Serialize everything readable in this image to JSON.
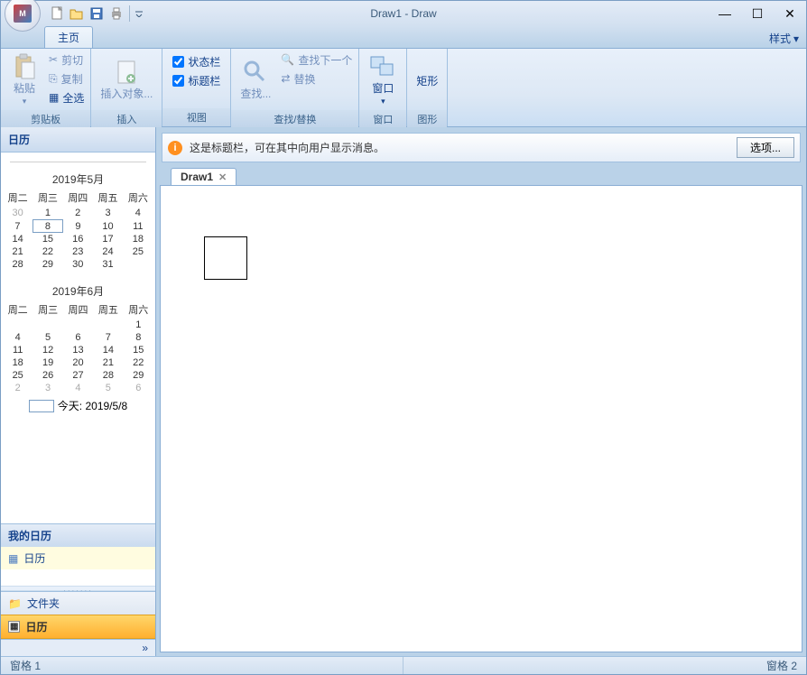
{
  "window": {
    "title": "Draw1 - Draw",
    "minimize": "—",
    "maximize": "☐",
    "close": "✕"
  },
  "qat": {
    "new": "新建",
    "open": "打开",
    "save": "保存",
    "print": "打印"
  },
  "tabs": {
    "home": "主页",
    "style_menu": "样式"
  },
  "ribbon": {
    "clipboard": {
      "label": "剪贴板",
      "paste": "粘贴",
      "cut": "剪切",
      "copy": "复制",
      "select_all": "全选"
    },
    "insert": {
      "label": "插入",
      "insert_object": "插入对象..."
    },
    "view": {
      "label": "视图",
      "statusbar": "状态栏",
      "titlebar": "标题栏"
    },
    "find_replace": {
      "label": "查找/替换",
      "find": "查找...",
      "find_next": "查找下一个",
      "replace": "替换"
    },
    "window": {
      "label": "窗口",
      "btn": "窗口"
    },
    "shapes": {
      "label": "图形",
      "rect": "矩形"
    }
  },
  "sidebar": {
    "calendar_title": "日历",
    "month1": {
      "title": "2019年5月",
      "dow": [
        "周二",
        "周三",
        "周四",
        "周五",
        "周六"
      ],
      "rows": [
        [
          {
            "v": "30",
            "dim": true
          },
          {
            "v": "1"
          },
          {
            "v": "2"
          },
          {
            "v": "3"
          },
          {
            "v": "4"
          }
        ],
        [
          {
            "v": "7"
          },
          {
            "v": "8",
            "sel": true
          },
          {
            "v": "9"
          },
          {
            "v": "10"
          },
          {
            "v": "11"
          }
        ],
        [
          {
            "v": "14"
          },
          {
            "v": "15"
          },
          {
            "v": "16"
          },
          {
            "v": "17"
          },
          {
            "v": "18"
          }
        ],
        [
          {
            "v": "21"
          },
          {
            "v": "22"
          },
          {
            "v": "23"
          },
          {
            "v": "24"
          },
          {
            "v": "25"
          }
        ],
        [
          {
            "v": "28"
          },
          {
            "v": "29"
          },
          {
            "v": "30"
          },
          {
            "v": "31"
          },
          {
            "v": ""
          }
        ]
      ]
    },
    "month2": {
      "title": "2019年6月",
      "dow": [
        "周二",
        "周三",
        "周四",
        "周五",
        "周六"
      ],
      "rows": [
        [
          {
            "v": ""
          },
          {
            "v": ""
          },
          {
            "v": ""
          },
          {
            "v": ""
          },
          {
            "v": "1"
          }
        ],
        [
          {
            "v": "4"
          },
          {
            "v": "5"
          },
          {
            "v": "6"
          },
          {
            "v": "7"
          },
          {
            "v": "8"
          }
        ],
        [
          {
            "v": "11"
          },
          {
            "v": "12"
          },
          {
            "v": "13"
          },
          {
            "v": "14"
          },
          {
            "v": "15"
          }
        ],
        [
          {
            "v": "18"
          },
          {
            "v": "19"
          },
          {
            "v": "20"
          },
          {
            "v": "21"
          },
          {
            "v": "22"
          }
        ],
        [
          {
            "v": "25"
          },
          {
            "v": "26"
          },
          {
            "v": "27"
          },
          {
            "v": "28"
          },
          {
            "v": "29"
          }
        ],
        [
          {
            "v": "2",
            "dim": true
          },
          {
            "v": "3",
            "dim": true
          },
          {
            "v": "4",
            "dim": true
          },
          {
            "v": "5",
            "dim": true
          },
          {
            "v": "6",
            "dim": true
          }
        ]
      ]
    },
    "today": "今天: 2019/5/8",
    "my_calendar_header": "我的日历",
    "my_calendar_item": "日历",
    "folder": "文件夹",
    "calendar_nav": "日历"
  },
  "infobar": {
    "text": "这是标题栏，可在其中向用户显示消息。",
    "button": "选项..."
  },
  "doc": {
    "tab_name": "Draw1"
  },
  "statusbar": {
    "pane1": "窗格 1",
    "pane2": "窗格 2"
  }
}
